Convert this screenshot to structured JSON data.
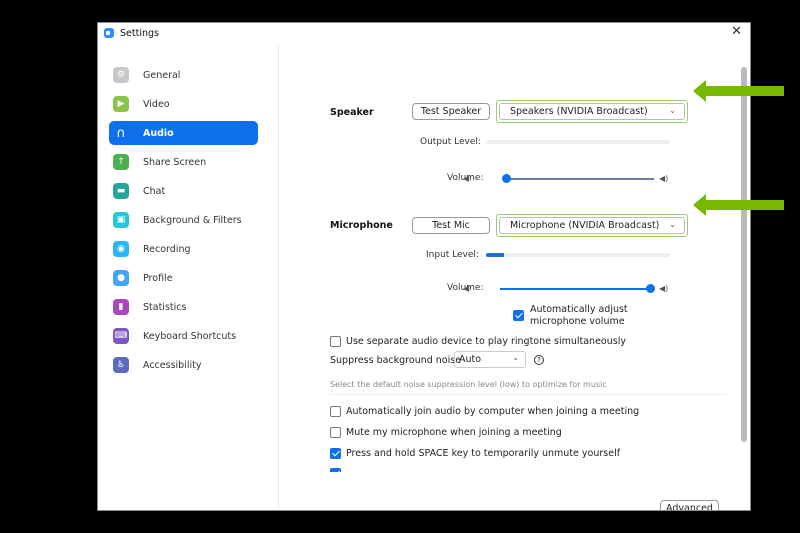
{
  "window": {
    "title": "Settings",
    "close_glyph": "✕"
  },
  "sidebar": {
    "items": [
      {
        "label": "General",
        "icon": "gear-icon",
        "glyph": "⚙",
        "color": "#c8c8c8"
      },
      {
        "label": "Video",
        "icon": "video-camera-icon",
        "glyph": "▶",
        "color": "#8bc34a"
      },
      {
        "label": "Audio",
        "icon": "headphones-icon",
        "glyph": "∩",
        "color": "#0e71eb",
        "active": true
      },
      {
        "label": "Share Screen",
        "icon": "share-screen-icon",
        "glyph": "↑",
        "color": "#4caf50"
      },
      {
        "label": "Chat",
        "icon": "chat-icon",
        "glyph": "▬",
        "color": "#26a69a"
      },
      {
        "label": "Background & Filters",
        "icon": "background-icon",
        "glyph": "▣",
        "color": "#26c6da"
      },
      {
        "label": "Recording",
        "icon": "recording-icon",
        "glyph": "◉",
        "color": "#29b6f6"
      },
      {
        "label": "Profile",
        "icon": "profile-icon",
        "glyph": "●",
        "color": "#42a5f5"
      },
      {
        "label": "Statistics",
        "icon": "statistics-icon",
        "glyph": "▮",
        "color": "#ab47bc"
      },
      {
        "label": "Keyboard Shortcuts",
        "icon": "keyboard-icon",
        "glyph": "⌨",
        "color": "#7e57c2"
      },
      {
        "label": "Accessibility",
        "icon": "accessibility-icon",
        "glyph": "♿",
        "color": "#5c6bc0"
      }
    ]
  },
  "speaker": {
    "label": "Speaker",
    "test_button": "Test Speaker",
    "device": "Speakers (NVIDIA Broadcast)",
    "output_level_label": "Output Level:",
    "output_level": 0,
    "volume_label": "Volume:",
    "volume": 0
  },
  "microphone": {
    "label": "Microphone",
    "test_button": "Test Mic",
    "device": "Microphone (NVIDIA Broadcast)",
    "input_level_label": "Input Level:",
    "input_level": 0.1,
    "volume_label": "Volume:",
    "volume": 1.0,
    "auto_adjust_label": "Automatically adjust microphone volume",
    "auto_adjust_checked": true
  },
  "options": {
    "separate_ringtone_label": "Use separate audio device to play ringtone simultaneously",
    "separate_ringtone_checked": false,
    "suppress_noise_label": "Suppress background noise",
    "suppress_noise_value": "Auto",
    "suppress_noise_hint": "Select the default noise suppression level (low) to optimize for music",
    "help_glyph": "?",
    "auto_join_label": "Automatically join audio by computer when joining a meeting",
    "auto_join_checked": false,
    "mute_on_join_label": "Mute my microphone when joining a meeting",
    "mute_on_join_checked": false,
    "space_unmute_label": "Press and hold SPACE key to temporarily unmute yourself",
    "space_unmute_checked": true,
    "clipped_row_checked": true
  },
  "footer": {
    "advanced_button": "Advanced"
  },
  "annotation": {
    "arrow_color": "#76b900"
  }
}
